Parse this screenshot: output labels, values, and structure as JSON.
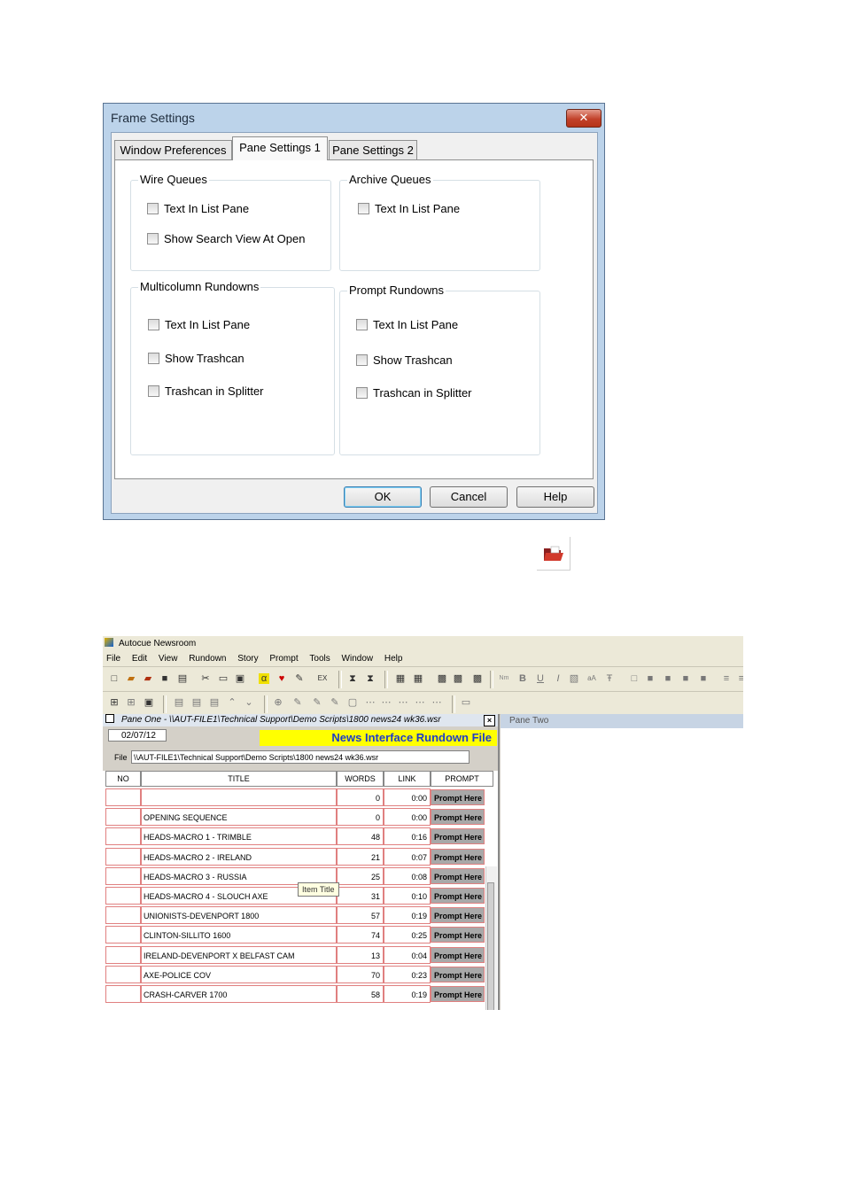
{
  "dialog": {
    "title": "Frame Settings",
    "close_glyph": "✕",
    "tabs": [
      "Window Preferences",
      "Pane Settings 1",
      "Pane Settings 2"
    ],
    "groups": {
      "wire": {
        "title": "Wire Queues",
        "items": [
          "Text In List Pane",
          "Show Search View At Open"
        ]
      },
      "archive": {
        "title": "Archive Queues",
        "items": [
          "Text In List Pane"
        ]
      },
      "multicolumn": {
        "title": "Multicolumn Rundowns",
        "items": [
          "Text In List Pane",
          "Show Trashcan",
          "Trashcan in Splitter"
        ]
      },
      "prompt": {
        "title": "Prompt Rundowns",
        "items": [
          "Text In List Pane",
          "Show Trashcan",
          "Trashcan in Splitter"
        ]
      }
    },
    "buttons": {
      "ok": "OK",
      "cancel": "Cancel",
      "help": "Help"
    }
  },
  "folder_icon": "open-folder-icon",
  "app": {
    "title": "Autocue Newsroom",
    "menu": [
      "File",
      "Edit",
      "View",
      "Rundown",
      "Story",
      "Prompt",
      "Tools",
      "Window",
      "Help"
    ],
    "pane_one": {
      "title": "Pane One - \\\\AUT-FILE1\\Technical Support\\Demo Scripts\\1800 news24 wk36.wsr",
      "date": "02/07/12",
      "banner": "News Interface Rundown File",
      "file_label": "File",
      "file_path": "\\\\AUT-FILE1\\Technical Support\\Demo Scripts\\1800 news24 wk36.wsr",
      "columns": [
        "NO",
        "TITLE",
        "WORDS",
        "LINK",
        "PROMPT"
      ],
      "tooltip": "Item Title",
      "rows": [
        {
          "no": "",
          "title": "",
          "words": "0",
          "link": "0:00",
          "prompt": "Prompt Here"
        },
        {
          "no": "",
          "title": "OPENING SEQUENCE",
          "words": "0",
          "link": "0:00",
          "prompt": "Prompt Here"
        },
        {
          "no": "",
          "title": "HEADS-MACRO 1 - TRIMBLE",
          "words": "48",
          "link": "0:16",
          "prompt": "Prompt Here"
        },
        {
          "no": "",
          "title": "HEADS-MACRO 2 - IRELAND",
          "words": "21",
          "link": "0:07",
          "prompt": "Prompt Here"
        },
        {
          "no": "",
          "title": "HEADS-MACRO 3 - RUSSIA",
          "words": "25",
          "link": "0:08",
          "prompt": "Prompt Here"
        },
        {
          "no": "",
          "title": "HEADS-MACRO 4 - SLOUCH AXE",
          "words": "31",
          "link": "0:10",
          "prompt": "Prompt Here"
        },
        {
          "no": "",
          "title": "UNIONISTS-DEVENPORT 1800",
          "words": "57",
          "link": "0:19",
          "prompt": "Prompt Here"
        },
        {
          "no": "",
          "title": "CLINTON-SILLITO 1600",
          "words": "74",
          "link": "0:25",
          "prompt": "Prompt Here"
        },
        {
          "no": "",
          "title": "IRELAND-DEVENPORT X BELFAST CAM",
          "words": "13",
          "link": "0:04",
          "prompt": "Prompt Here"
        },
        {
          "no": "",
          "title": "AXE-POLICE COV",
          "words": "70",
          "link": "0:23",
          "prompt": "Prompt Here"
        },
        {
          "no": "",
          "title": "CRASH-CARVER 1700",
          "words": "58",
          "link": "0:19",
          "prompt": "Prompt Here"
        }
      ]
    },
    "pane_two": {
      "title": "Pane Two"
    }
  }
}
